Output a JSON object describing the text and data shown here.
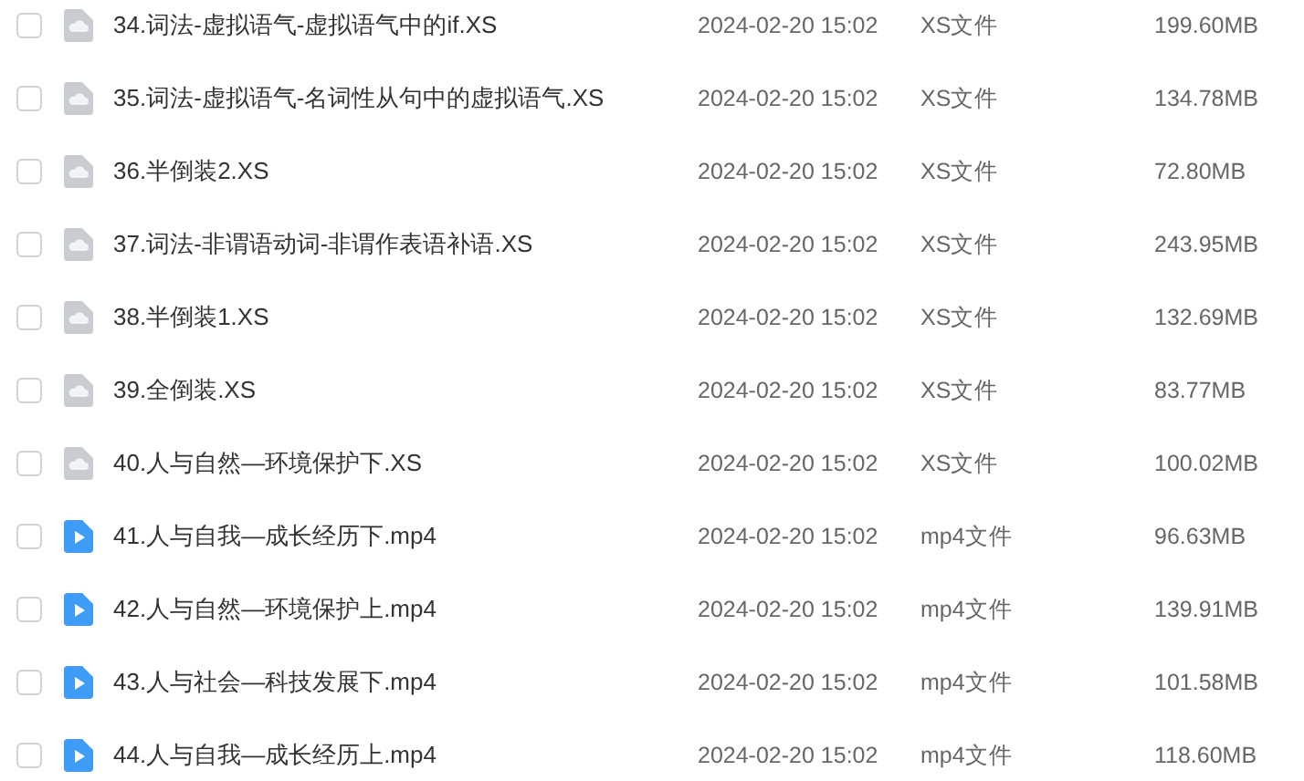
{
  "files": [
    {
      "name": "34.词法-虚拟语气-虚拟语气中的if.XS",
      "date": "2024-02-20 15:02",
      "type": "XS文件",
      "size": "199.60MB",
      "kind": "doc",
      "checked": false
    },
    {
      "name": "35.词法-虚拟语气-名词性从句中的虚拟语气.XS",
      "date": "2024-02-20 15:02",
      "type": "XS文件",
      "size": "134.78MB",
      "kind": "doc",
      "checked": false
    },
    {
      "name": "36.半倒装2.XS",
      "date": "2024-02-20 15:02",
      "type": "XS文件",
      "size": "72.80MB",
      "kind": "doc",
      "checked": false
    },
    {
      "name": "37.词法-非谓语动词-非谓作表语补语.XS",
      "date": "2024-02-20 15:02",
      "type": "XS文件",
      "size": "243.95MB",
      "kind": "doc",
      "checked": false
    },
    {
      "name": "38.半倒装1.XS",
      "date": "2024-02-20 15:02",
      "type": "XS文件",
      "size": "132.69MB",
      "kind": "doc",
      "checked": false
    },
    {
      "name": "39.全倒装.XS",
      "date": "2024-02-20 15:02",
      "type": "XS文件",
      "size": "83.77MB",
      "kind": "doc",
      "checked": false
    },
    {
      "name": "40.人与自然—环境保护下.XS",
      "date": "2024-02-20 15:02",
      "type": "XS文件",
      "size": "100.02MB",
      "kind": "doc",
      "checked": false
    },
    {
      "name": "41.人与自我—成长经历下.mp4",
      "date": "2024-02-20 15:02",
      "type": "mp4文件",
      "size": "96.63MB",
      "kind": "video",
      "checked": false
    },
    {
      "name": "42.人与自然—环境保护上.mp4",
      "date": "2024-02-20 15:02",
      "type": "mp4文件",
      "size": "139.91MB",
      "kind": "video",
      "checked": false
    },
    {
      "name": "43.人与社会—科技发展下.mp4",
      "date": "2024-02-20 15:02",
      "type": "mp4文件",
      "size": "101.58MB",
      "kind": "video",
      "checked": false
    },
    {
      "name": "44.人与自我—成长经历上.mp4",
      "date": "2024-02-20 15:02",
      "type": "mp4文件",
      "size": "118.60MB",
      "kind": "video",
      "checked": false
    }
  ]
}
